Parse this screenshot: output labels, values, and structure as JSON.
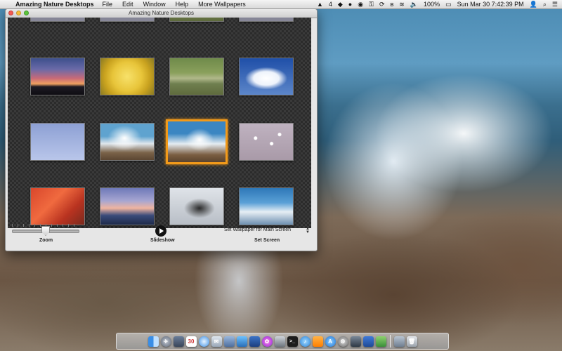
{
  "menubar": {
    "apple_icon": "apple-logo-icon",
    "app_name": "Amazing Nature Desktops",
    "menus": [
      "File",
      "Edit",
      "Window",
      "Help",
      "More Wallpapers"
    ],
    "tray": {
      "notification_count": "4",
      "battery_percent": "100%",
      "clock": "Sun Mar 30   7:42:39 PM"
    }
  },
  "window": {
    "title": "Amazing Nature Desktops",
    "thumbnails": [
      {
        "name": "sunset",
        "selected": false
      },
      {
        "name": "yellow-rose",
        "selected": false
      },
      {
        "name": "alligator",
        "selected": false
      },
      {
        "name": "clouds",
        "selected": false
      },
      {
        "name": "birds-flying",
        "selected": false
      },
      {
        "name": "wave-splash",
        "selected": false
      },
      {
        "name": "wave-on-rocks",
        "selected": true
      },
      {
        "name": "water-drops",
        "selected": false
      },
      {
        "name": "red-leaves",
        "selected": false
      },
      {
        "name": "dusk-sky",
        "selected": false
      },
      {
        "name": "eagle",
        "selected": false
      },
      {
        "name": "surfer",
        "selected": false
      }
    ],
    "controls": {
      "zoom_label": "Zoom",
      "zoom_level": 0.5,
      "slideshow_label": "Slideshow",
      "screen_option": "Set Wallpaper for Main Screen",
      "set_screen_label": "Set Screen"
    }
  },
  "dock": {
    "items": [
      "finder",
      "launchpad",
      "mission-control",
      "calendar",
      "safari",
      "mail",
      "preview",
      "photos",
      "terminal",
      "itunes",
      "app-store",
      "system-preferences",
      "activity",
      "downloads",
      "trash"
    ],
    "calendar_day": "30"
  },
  "colors": {
    "selection": "#f29a1a",
    "window_bg": "#e6e6e6"
  }
}
